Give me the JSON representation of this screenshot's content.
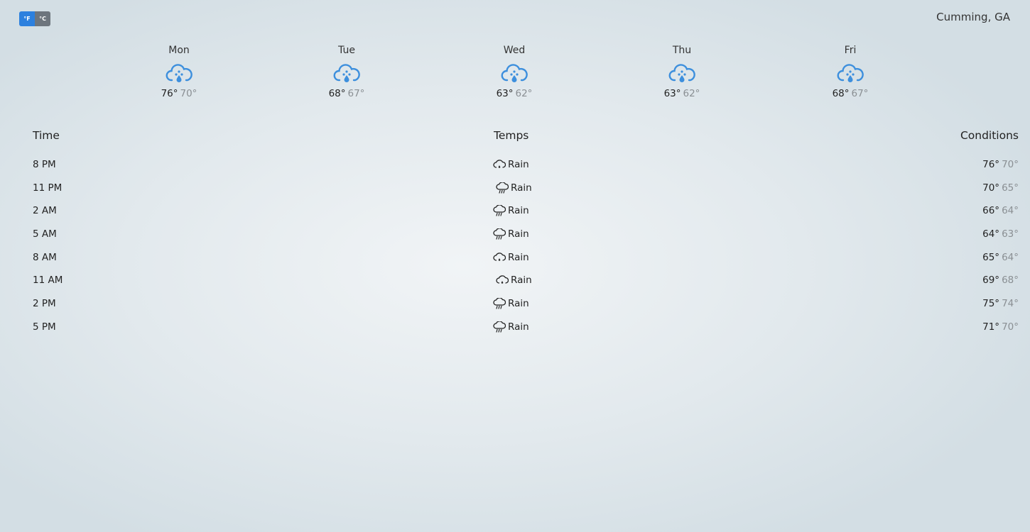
{
  "units": {
    "f_label": "°F",
    "c_label": "°C",
    "active": "F"
  },
  "location": "Cumming, GA",
  "days": [
    {
      "name": "Mon",
      "icon": "rain-cloud-icon",
      "high": "76°",
      "low": "70°"
    },
    {
      "name": "Tue",
      "icon": "rain-cloud-icon",
      "high": "68°",
      "low": "67°"
    },
    {
      "name": "Wed",
      "icon": "rain-cloud-icon",
      "high": "63°",
      "low": "62°"
    },
    {
      "name": "Thu",
      "icon": "rain-cloud-icon",
      "high": "63°",
      "low": "62°"
    },
    {
      "name": "Fri",
      "icon": "rain-cloud-icon",
      "high": "68°",
      "low": "67°"
    }
  ],
  "hourly": {
    "headers": {
      "time": "Time",
      "temps": "Temps",
      "conditions": "Conditions"
    },
    "rows": [
      {
        "time": "8 PM",
        "icon": "cloud-drizzle-icon",
        "condition": "Rain",
        "high": "76°",
        "low": "70°"
      },
      {
        "time": "11 PM",
        "icon": "cloud-rain-icon",
        "condition": "Rain",
        "high": "70°",
        "low": "65°"
      },
      {
        "time": "2 AM",
        "icon": "cloud-rain-icon",
        "condition": "Rain",
        "high": "66°",
        "low": "64°"
      },
      {
        "time": "5 AM",
        "icon": "cloud-rain-icon",
        "condition": "Rain",
        "high": "64°",
        "low": "63°"
      },
      {
        "time": "8 AM",
        "icon": "cloud-drizzle-icon",
        "condition": "Rain",
        "high": "65°",
        "low": "64°"
      },
      {
        "time": "11 AM",
        "icon": "cloud-drizzle-icon",
        "condition": "Rain",
        "high": "69°",
        "low": "68°"
      },
      {
        "time": "2 PM",
        "icon": "cloud-rain-icon",
        "condition": "Rain",
        "high": "75°",
        "low": "74°"
      },
      {
        "time": "5 PM",
        "icon": "cloud-rain-icon",
        "condition": "Rain",
        "high": "71°",
        "low": "70°"
      }
    ]
  },
  "colors": {
    "accent": "#2c80de",
    "icon_blue": "#3d8fdd",
    "muted": "#8a8f93"
  }
}
